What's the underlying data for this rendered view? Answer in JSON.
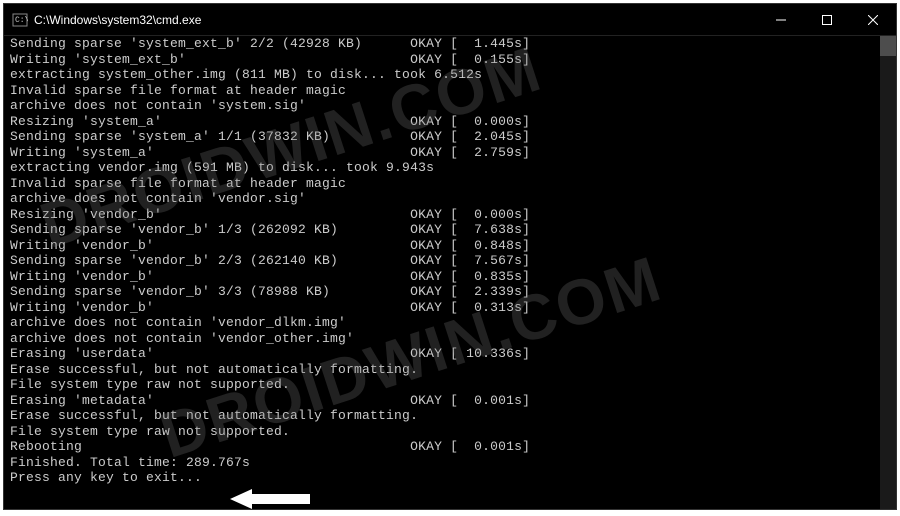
{
  "window": {
    "title": "C:\\Windows\\system32\\cmd.exe"
  },
  "watermark": "DROIDWIN.COM",
  "console": {
    "lines": [
      "Sending sparse 'system_ext_b' 2/2 (42928 KB)      OKAY [  1.445s]",
      "Writing 'system_ext_b'                            OKAY [  0.155s]",
      "extracting system_other.img (811 MB) to disk... took 6.512s",
      "Invalid sparse file format at header magic",
      "archive does not contain 'system.sig'",
      "Resizing 'system_a'                               OKAY [  0.000s]",
      "Sending sparse 'system_a' 1/1 (37832 KB)          OKAY [  2.045s]",
      "Writing 'system_a'                                OKAY [  2.759s]",
      "extracting vendor.img (591 MB) to disk... took 9.943s",
      "Invalid sparse file format at header magic",
      "archive does not contain 'vendor.sig'",
      "Resizing 'vendor_b'                               OKAY [  0.000s]",
      "Sending sparse 'vendor_b' 1/3 (262092 KB)         OKAY [  7.638s]",
      "Writing 'vendor_b'                                OKAY [  0.848s]",
      "Sending sparse 'vendor_b' 2/3 (262140 KB)         OKAY [  7.567s]",
      "Writing 'vendor_b'                                OKAY [  0.835s]",
      "Sending sparse 'vendor_b' 3/3 (78988 KB)          OKAY [  2.339s]",
      "Writing 'vendor_b'                                OKAY [  0.313s]",
      "archive does not contain 'vendor_dlkm.img'",
      "archive does not contain 'vendor_other.img'",
      "Erasing 'userdata'                                OKAY [ 10.336s]",
      "Erase successful, but not automatically formatting.",
      "File system type raw not supported.",
      "Erasing 'metadata'                                OKAY [  0.001s]",
      "Erase successful, but not automatically formatting.",
      "File system type raw not supported.",
      "Rebooting                                         OKAY [  0.001s]",
      "Finished. Total time: 289.767s",
      "Press any key to exit..."
    ]
  }
}
